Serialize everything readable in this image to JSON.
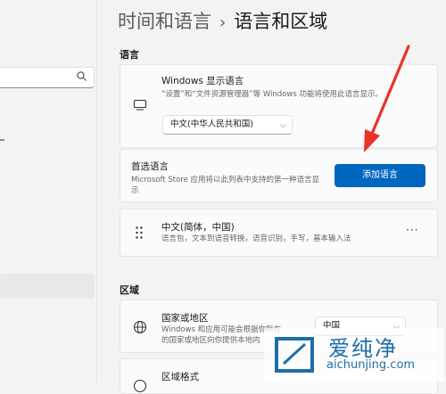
{
  "header": {
    "parent": "时间和语言",
    "chevron": "›",
    "current": "语言和区域"
  },
  "language_section": {
    "heading": "语言",
    "display_language": {
      "title": "Windows 显示语言",
      "description": "“设置”和“文件资源管理器”等 Windows 功能将使用此语言显示。",
      "selected": "中文(中华人民共和国)",
      "icon": "monitor-icon"
    },
    "preferred": {
      "title": "首选语言",
      "description": "Microsoft Store 应用将以此列表中支持的第一种语言显示",
      "button_label": "添加语言"
    },
    "installed": {
      "title": "中文(简体，中国)",
      "features": "语言包，文本到语音转换，语音识别，手写，基本输入法",
      "more": "···"
    }
  },
  "region_section": {
    "heading": "区域",
    "country": {
      "title": "国家或地区",
      "description_line1": "Windows 和应用可能会根据你所在",
      "description_line2": "的国家或地区向你提供本地内",
      "selected": "中国",
      "icon": "globe-icon"
    },
    "format": {
      "title": "区域格式"
    }
  },
  "watermark": {
    "brand": "爱纯净",
    "url": "aichunjing.com"
  },
  "colors": {
    "accent": "#0067c0",
    "annotation_arrow": "#e8322a"
  }
}
